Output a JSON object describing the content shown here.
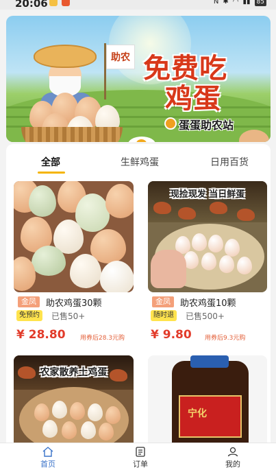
{
  "status_bar": {
    "time": "20:06",
    "battery": "85"
  },
  "banner": {
    "flag_text": "助农",
    "headline_line1": "免费吃",
    "headline_line2": "鸡蛋",
    "brand_name": "蛋蛋助农站"
  },
  "tabs": [
    {
      "label": "全部",
      "active": true
    },
    {
      "label": "生鲜鸡蛋",
      "active": false
    },
    {
      "label": "日用百货",
      "active": false
    }
  ],
  "products": [
    {
      "brand_tag": "金凤",
      "title": "助农鸡蛋30颗",
      "badge": "免预约",
      "sold": "已售50+",
      "price": "¥ 28.80",
      "coupon_note": "用券后28.3元购"
    },
    {
      "brand_tag": "金凤",
      "title": "助农鸡蛋10颗",
      "badge": "随时退",
      "sold": "已售500+",
      "price": "¥ 9.80",
      "coupon_note": "用券后9.3元购",
      "image_caption": "现捡现发 当日鲜蛋"
    },
    {
      "image_caption": "农家散养土鸡蛋"
    },
    {
      "image_caption": "宁化"
    }
  ],
  "bottom_nav": [
    {
      "label": "首页",
      "icon": "home-icon",
      "active": true
    },
    {
      "label": "订单",
      "icon": "order-icon",
      "active": false
    },
    {
      "label": "我的",
      "icon": "profile-icon",
      "active": false
    }
  ],
  "colors": {
    "accent": "#f5b400",
    "price": "#e23b2a",
    "nav_active": "#3a73c9",
    "brand_tag": "#f4a07a",
    "badge": "#ffe34d"
  }
}
